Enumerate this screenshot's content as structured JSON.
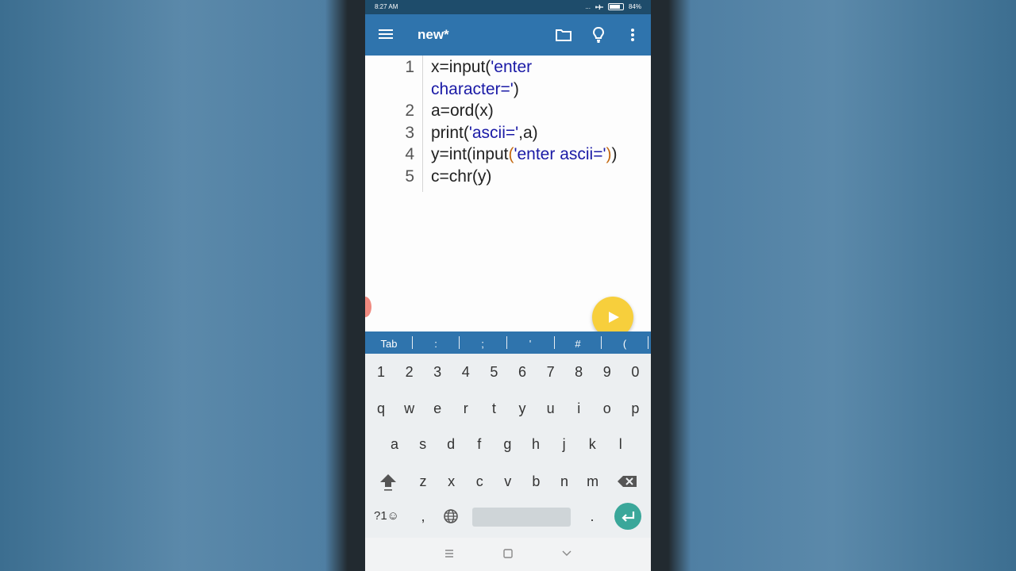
{
  "status": {
    "time": "8:27 AM",
    "dots": "...",
    "battery_text": "84%"
  },
  "appbar": {
    "title": "new*"
  },
  "code": [
    {
      "num": "1",
      "segments": [
        {
          "t": "x=input(",
          "c": "plain"
        },
        {
          "t": "'enter",
          "c": "str"
        }
      ]
    },
    {
      "num": "",
      "segments": [
        {
          "t": "character='",
          "c": "str"
        },
        {
          "t": ")",
          "c": "plain"
        }
      ]
    },
    {
      "num": "2",
      "segments": [
        {
          "t": "a=ord(x)",
          "c": "plain"
        }
      ]
    },
    {
      "num": "3",
      "segments": [
        {
          "t": "print(",
          "c": "plain"
        },
        {
          "t": "'ascii='",
          "c": "str"
        },
        {
          "t": ",a)",
          "c": "plain"
        }
      ]
    },
    {
      "num": "4",
      "segments": [
        {
          "t": "y=int(input",
          "c": "plain"
        },
        {
          "t": "(",
          "c": "p1"
        },
        {
          "t": "'enter ascii='",
          "c": "str"
        },
        {
          "t": ")",
          "c": "p1"
        },
        {
          "t": ")",
          "c": "plain"
        }
      ]
    },
    {
      "num": "5",
      "segments": [
        {
          "t": "c=chr(y)",
          "c": "plain"
        }
      ]
    }
  ],
  "symbols": [
    "Tab",
    ":",
    ";",
    "'",
    "#",
    "("
  ],
  "keyboard": {
    "row1": [
      "1",
      "2",
      "3",
      "4",
      "5",
      "6",
      "7",
      "8",
      "9",
      "0"
    ],
    "row2": [
      "q",
      "w",
      "e",
      "r",
      "t",
      "y",
      "u",
      "i",
      "o",
      "p"
    ],
    "row3": [
      "a",
      "s",
      "d",
      "f",
      "g",
      "h",
      "j",
      "k",
      "l"
    ],
    "row4": [
      "z",
      "x",
      "c",
      "v",
      "b",
      "n",
      "m"
    ],
    "row5": {
      "sym_label": "?1☺",
      "comma": ",",
      "period": "."
    }
  },
  "colors": {
    "appbar": "#2f74ad",
    "statusbar": "#1e4c6b",
    "fab": "#f7cf3c",
    "enter": "#3aa79a",
    "string": "#1a1aa6"
  }
}
